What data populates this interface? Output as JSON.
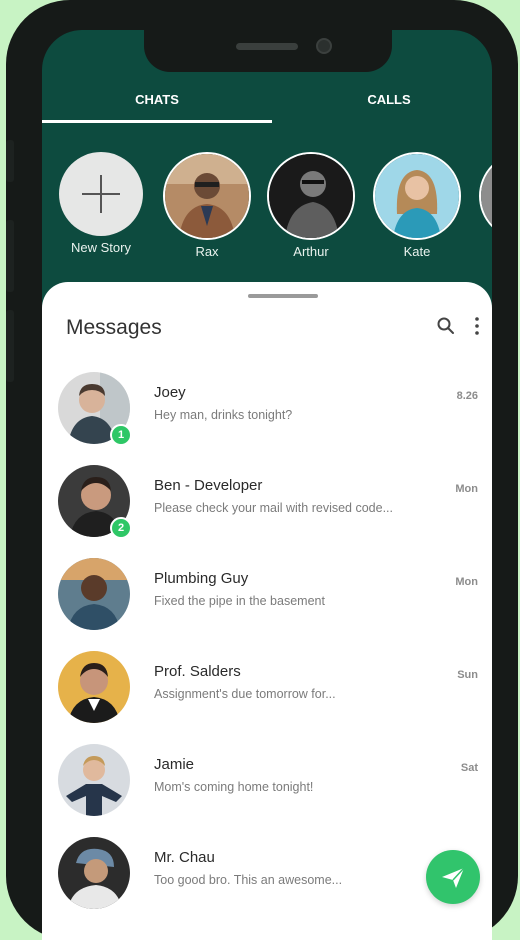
{
  "tabs": {
    "chats": "CHATS",
    "calls": "CALLS"
  },
  "stories": [
    {
      "label": "New Story"
    },
    {
      "label": "Rax"
    },
    {
      "label": "Arthur"
    },
    {
      "label": "Kate"
    }
  ],
  "messages": {
    "title": "Messages",
    "items": [
      {
        "name": "Joey",
        "preview": "Hey man, drinks tonight?",
        "time": "8.26",
        "unread": "1"
      },
      {
        "name": "Ben - Developer",
        "preview": "Please check your mail with revised code...",
        "time": "Mon",
        "unread": "2"
      },
      {
        "name": "Plumbing Guy",
        "preview": "Fixed the pipe in the basement",
        "time": "Mon"
      },
      {
        "name": "Prof. Salders",
        "preview": "Assignment's due tomorrow for...",
        "time": "Sun"
      },
      {
        "name": "Jamie",
        "preview": "Mom's coming home tonight!",
        "time": "Sat"
      },
      {
        "name": "Mr. Chau",
        "preview": "Too good bro. This an awesome..."
      }
    ]
  },
  "colors": {
    "header": "#0d4b3f",
    "accent_green": "#31c46c",
    "background": "#c8f3c4"
  },
  "icons": [
    "search-icon",
    "more-vertical-icon",
    "plus-icon",
    "send-icon"
  ]
}
